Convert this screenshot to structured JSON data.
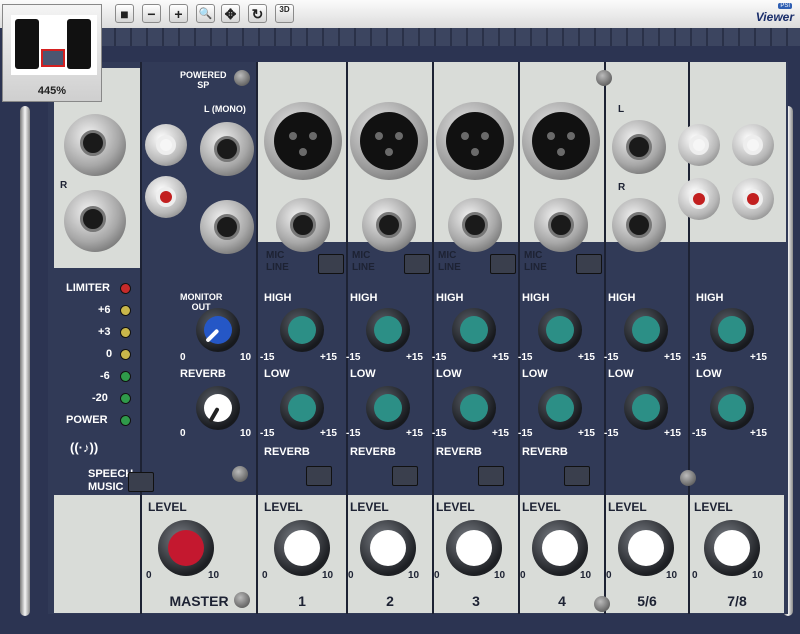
{
  "toolbar": {
    "stop_icon": "■",
    "minus_icon": "−",
    "plus_icon": "+",
    "magnify_icon": "🔍",
    "move_icon": "✥",
    "rotate_icon": "↻",
    "view3d_label": "3D"
  },
  "navigator": {
    "zoom": "445%"
  },
  "logo": {
    "name": "Viewer",
    "badge": "PSI"
  },
  "mixer": {
    "powered_sp": "POWERED\nSP",
    "l_mono": "L (MONO)",
    "meter": {
      "labels": [
        "LIMITER",
        "+6",
        "+3",
        "0",
        "-6",
        "-20",
        "POWER"
      ],
      "colors": [
        "#c62a2a",
        "#c8b64a",
        "#c8b64a",
        "#c8b64a",
        "#2f9a4a",
        "#2f9a4a",
        "#2f9a4a"
      ]
    },
    "monitor_out": "MONITOR\nOUT",
    "reverb": "REVERB",
    "speech": "SPEECH",
    "music": "MUSIC",
    "level": "LEVEL",
    "scale_0": "0",
    "scale_10": "10",
    "scale_m15": "-15",
    "scale_p15": "+15",
    "high": "HIGH",
    "low": "LOW",
    "mic": "MIC",
    "line": "LINE",
    "l": "L",
    "r": "R",
    "channels": [
      "MASTER",
      "1",
      "2",
      "3",
      "4",
      "5/6",
      "7/8"
    ]
  }
}
